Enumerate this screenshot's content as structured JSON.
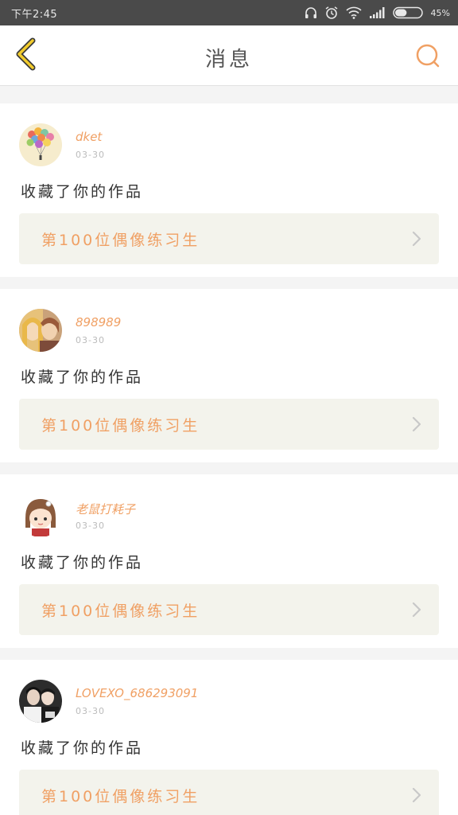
{
  "status_bar": {
    "time": "下午2:45",
    "battery_percent": "45%",
    "battery_level": 0.45,
    "icons": [
      "headphones-icon",
      "alarm-icon",
      "wifi-icon",
      "signal-icon",
      "battery-icon"
    ]
  },
  "header": {
    "title": "消息",
    "back_icon": "chevron-left-icon",
    "search_icon": "search-icon"
  },
  "colors": {
    "accent": "#f0a064",
    "back_yellow": "#f2cc2c",
    "card_bg": "#ffffff",
    "work_box_bg": "#f3f3ec",
    "page_bg": "#f4f4f4"
  },
  "messages": [
    {
      "username": "dket",
      "time": "03-30",
      "action": "收藏了你的作品",
      "work_title": "第100位偶像练习生",
      "avatar": "balloons-avatar"
    },
    {
      "username": "898989",
      "time": "03-30",
      "action": "收藏了你的作品",
      "work_title": "第100位偶像练习生",
      "avatar": "anime-couple-avatar"
    },
    {
      "username": "老鼠打耗子",
      "time": "03-30",
      "action": "收藏了你的作品",
      "work_title": "第100位偶像练习生",
      "avatar": "chibi-girl-avatar"
    },
    {
      "username": "LOVEXO_686293091",
      "time": "03-30",
      "action": "收藏了你的作品",
      "work_title": "第100位偶像练习生",
      "avatar": "photo-couple-avatar"
    }
  ]
}
